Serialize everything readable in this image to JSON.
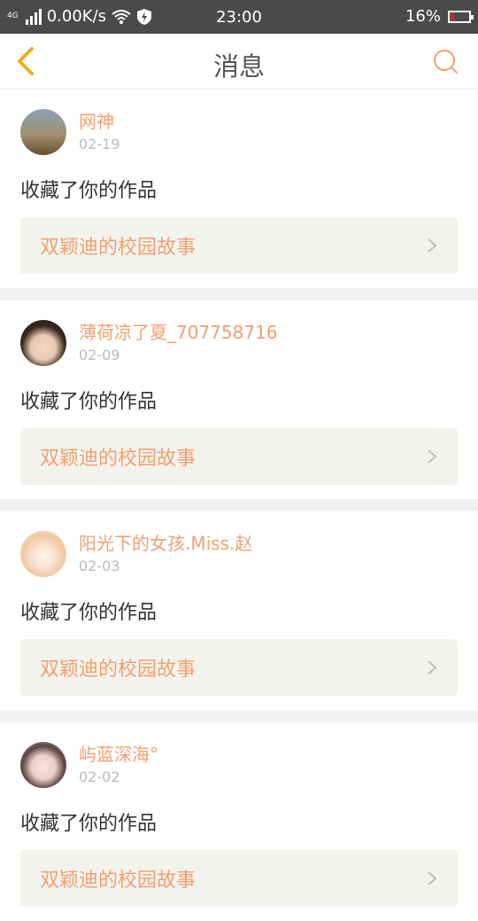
{
  "status_bar": {
    "network": "4G",
    "speed": "0.00K/s",
    "time": "23:00",
    "battery": "16%"
  },
  "header": {
    "title": "消息"
  },
  "messages": [
    {
      "user": "网神",
      "date": "02-19",
      "action": "收藏了你的作品",
      "work_title": "双颖迪的校园故事"
    },
    {
      "user": "薄荷凉了夏_707758716",
      "date": "02-09",
      "action": "收藏了你的作品",
      "work_title": "双颖迪的校园故事"
    },
    {
      "user": "阳光下的女孩.Miss.赵",
      "date": "02-03",
      "action": "收藏了你的作品",
      "work_title": "双颖迪的校园故事"
    },
    {
      "user": "屿蓝深海°",
      "date": "02-02",
      "action": "收藏了你的作品",
      "work_title": "双颖迪的校园故事"
    }
  ],
  "colors": {
    "accent": "#f0a070",
    "back_icon": "#e8b020",
    "statusbar_bg": "#4a4a4a"
  },
  "icons": {
    "back": "chevron-left-icon",
    "search": "search-icon",
    "work_link": "chevron-right-icon"
  }
}
